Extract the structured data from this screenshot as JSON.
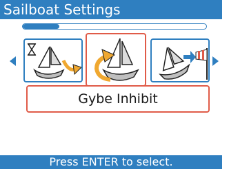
{
  "title": "Sailboat Settings",
  "menu_progress": 0.2,
  "carousel": {
    "items": [
      {
        "icon": "sailboat-hourglass-turn-icon"
      },
      {
        "icon": "sailboat-gybe-inhibit-icon",
        "selected": true
      },
      {
        "icon": "sailboat-wind-icon"
      }
    ],
    "left_arrow_icon": "triangle-left-icon",
    "right_arrow_icon": "triangle-right-icon"
  },
  "selected_label": "Gybe Inhibit",
  "footer_hint": "Press ENTER to select.",
  "colors": {
    "accent": "#2f7fc0",
    "selection": "#e05b48",
    "turn_arrow": "#f0a830"
  }
}
